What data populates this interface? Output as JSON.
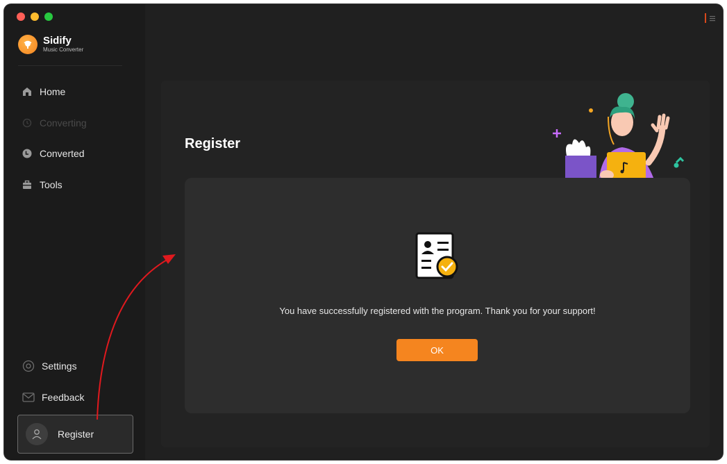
{
  "app": {
    "name": "Sidify",
    "subtitle": "Music Converter"
  },
  "sidebar": {
    "items": [
      {
        "label": "Home",
        "icon": "home-icon",
        "enabled": true
      },
      {
        "label": "Converting",
        "icon": "converting-icon",
        "enabled": false
      },
      {
        "label": "Converted",
        "icon": "clock-icon",
        "enabled": true
      },
      {
        "label": "Tools",
        "icon": "toolbox-icon",
        "enabled": true
      }
    ],
    "bottom_items": [
      {
        "label": "Settings",
        "icon": "settings-icon"
      },
      {
        "label": "Feedback",
        "icon": "mail-icon"
      }
    ],
    "register_label": "Register"
  },
  "main": {
    "title": "Register",
    "dialog": {
      "message": "You have successfully registered with the program. Thank you for your support!",
      "ok_label": "OK"
    }
  },
  "colors": {
    "accent": "#f5851f",
    "background": "#202020",
    "sidebar": "#1b1b1b",
    "dialog": "#2d2d2d",
    "annotation_arrow": "#e0191e"
  }
}
